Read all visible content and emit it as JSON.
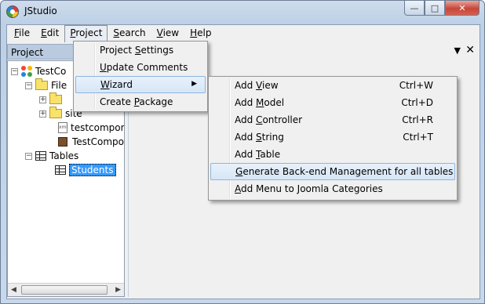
{
  "window": {
    "title": "JStudio",
    "controls": {
      "minimize": "—",
      "maximize": "□",
      "close": "✕"
    }
  },
  "menubar": [
    {
      "pre": "",
      "ul": "F",
      "post": "ile"
    },
    {
      "pre": "",
      "ul": "E",
      "post": "dit"
    },
    {
      "pre": "",
      "ul": "P",
      "post": "roject"
    },
    {
      "pre": "",
      "ul": "S",
      "post": "earch"
    },
    {
      "pre": "",
      "ul": "V",
      "post": "iew"
    },
    {
      "pre": "",
      "ul": "H",
      "post": "elp"
    }
  ],
  "left_panel": {
    "title": "Project",
    "tree": [
      {
        "label": "TestCo",
        "icon": "joomla-icon",
        "expander": "−"
      },
      {
        "label": "File",
        "icon": "folder-icon",
        "expander": "−"
      },
      {
        "label": "",
        "icon": "folder-icon",
        "expander": "+"
      },
      {
        "label": "site",
        "icon": "folder-icon",
        "expander": "+"
      },
      {
        "label": "testcompon",
        "icon": "xml-file-icon",
        "expander": ""
      },
      {
        "label": "TestCompor",
        "icon": "package-icon",
        "expander": ""
      },
      {
        "label": "Tables",
        "icon": "table-icon",
        "expander": "−"
      },
      {
        "label": "Students",
        "icon": "table-icon",
        "expander": "",
        "selected": true
      }
    ]
  },
  "project_menu": [
    {
      "pre": "Project ",
      "ul": "S",
      "post": "ettings"
    },
    {
      "pre": "",
      "ul": "U",
      "post": "pdate Comments"
    },
    {
      "pre": "",
      "ul": "W",
      "post": "izard",
      "submenu": true
    },
    {
      "pre": "Create ",
      "ul": "P",
      "post": "ackage"
    }
  ],
  "wizard_menu": [
    {
      "pre": "Add ",
      "ul": "V",
      "post": "iew",
      "shortcut": "Ctrl+W"
    },
    {
      "pre": "Add ",
      "ul": "M",
      "post": "odel",
      "shortcut": "Ctrl+D"
    },
    {
      "pre": "Add ",
      "ul": "C",
      "post": "ontroller",
      "shortcut": "Ctrl+R"
    },
    {
      "pre": "Add ",
      "ul": "S",
      "post": "tring",
      "shortcut": "Ctrl+T"
    },
    {
      "pre": "Add ",
      "ul": "T",
      "post": "able",
      "shortcut": ""
    },
    {
      "pre": "",
      "ul": "G",
      "post": "enerate Back-end Management for all tables",
      "shortcut": ""
    },
    {
      "pre": "",
      "ul": "A",
      "post": "dd Menu to Joomla Categories",
      "shortcut": ""
    }
  ],
  "right_panel": {
    "pin_icon": "▼",
    "close_icon": "✕"
  },
  "scrollbar": {
    "left_arrow": "◀",
    "right_arrow": "▶"
  }
}
